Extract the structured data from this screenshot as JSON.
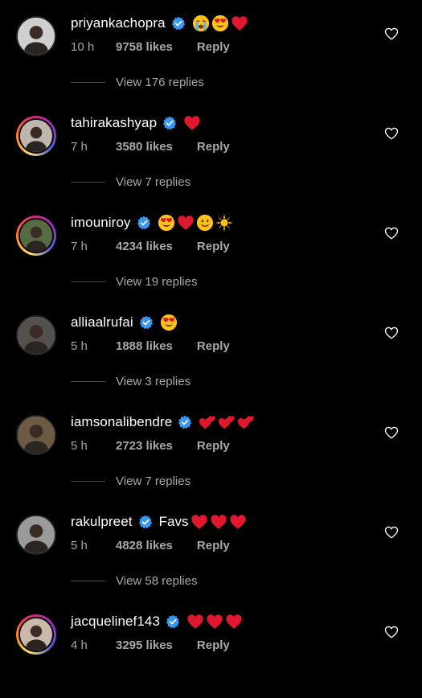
{
  "comments": [
    {
      "username": "priyankachopra",
      "text": "",
      "emojis": [
        "crying",
        "heart-eyes",
        "red-heart"
      ],
      "time": "10 h",
      "likes": "9758 likes",
      "reply": "Reply",
      "replies": "View 176 replies",
      "ring": false
    },
    {
      "username": "tahirakashyap",
      "text": "",
      "emojis": [
        "red-heart"
      ],
      "time": "7 h",
      "likes": "3580 likes",
      "reply": "Reply",
      "replies": "View 7 replies",
      "ring": true
    },
    {
      "username": "imouniroy",
      "text": "",
      "emojis": [
        "heart-eyes",
        "red-heart",
        "smile",
        "sun"
      ],
      "time": "7 h",
      "likes": "4234 likes",
      "reply": "Reply",
      "replies": "View 19 replies",
      "ring": true
    },
    {
      "username": "alliaalrufai",
      "text": "",
      "emojis": [
        "heart-eyes"
      ],
      "time": "5 h",
      "likes": "1888 likes",
      "reply": "Reply",
      "replies": "View 3 replies",
      "ring": false
    },
    {
      "username": "iamsonalibendre",
      "text": "",
      "emojis": [
        "two-hearts",
        "two-hearts",
        "two-hearts"
      ],
      "time": "5 h",
      "likes": "2723 likes",
      "reply": "Reply",
      "replies": "View 7 replies",
      "ring": false
    },
    {
      "username": "rakulpreet",
      "text": "Favs",
      "emojis": [
        "red-heart",
        "red-heart",
        "red-heart"
      ],
      "time": "5 h",
      "likes": "4828 likes",
      "reply": "Reply",
      "replies": "View 58 replies",
      "ring": false
    },
    {
      "username": "jacquelinef143",
      "text": "",
      "emojis": [
        "red-heart",
        "red-heart",
        "red-heart"
      ],
      "time": "4 h",
      "likes": "3295 likes",
      "reply": "Reply",
      "replies": "",
      "ring": true
    }
  ],
  "colors": {
    "background": "#000000",
    "verified": "#3897f0",
    "meta": "#a8a8a8",
    "heart": "#e0182d"
  }
}
